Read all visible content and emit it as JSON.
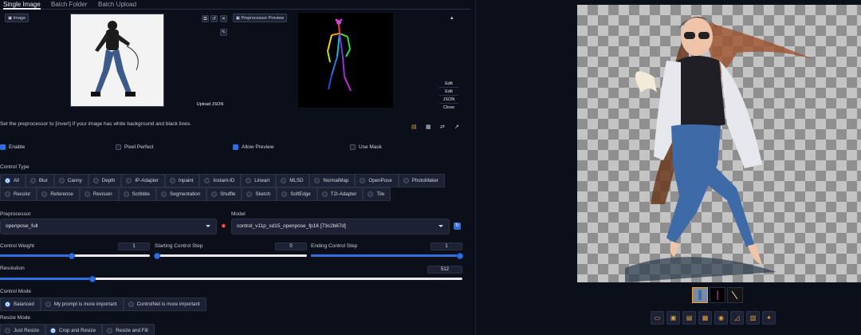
{
  "tabs": [
    {
      "label": "Single Image"
    },
    {
      "label": "Batch Folder"
    },
    {
      "label": "Batch Upload"
    }
  ],
  "image_panel": {
    "chip_label": "Image",
    "upload_json": "Upload JSON",
    "small_btns": [
      "⧉",
      "↺",
      "✕",
      "✎"
    ]
  },
  "preview_panel": {
    "chip_label": "Preprocessor Preview",
    "collapse": "▴"
  },
  "side_buttons": [
    "Edit",
    "Edit",
    "JSON",
    "Close"
  ],
  "hint": "Set the preprocessor to [invert] If your image has white background and black lines.",
  "checkboxes": [
    {
      "label": "Enable",
      "checked": true
    },
    {
      "label": "Pixel Perfect",
      "checked": false
    },
    {
      "label": "Allow Preview",
      "checked": true
    },
    {
      "label": "Use Mask",
      "checked": false
    }
  ],
  "control_type": {
    "label": "Control Type",
    "options": [
      "All",
      "Blur",
      "Canny",
      "Depth",
      "IP-Adapter",
      "Inpaint",
      "Instant-ID",
      "Lineart",
      "MLSD",
      "NormalMap",
      "OpenPose",
      "PhotoMaker",
      "Recolor",
      "Reference",
      "Revision",
      "Scribble",
      "Segmentation",
      "Shuffle",
      "Sketch",
      "SoftEdge",
      "T2I-Adapter",
      "Tile"
    ],
    "selected": "All"
  },
  "preprocessor": {
    "label": "Preprocessor",
    "value": "openpose_full"
  },
  "model": {
    "label": "Model",
    "value": "control_v11p_sd15_openpose_fp16 [73c2b67d]"
  },
  "sliders": {
    "control_weight": {
      "label": "Control Weight",
      "value": "1",
      "fraction": 0.48
    },
    "starting_step": {
      "label": "Starting Control Step",
      "value": "0",
      "fraction": 0.0
    },
    "ending_step": {
      "label": "Ending Control Step",
      "value": "1",
      "fraction": 1.0
    },
    "resolution": {
      "label": "Resolution",
      "value": "512",
      "fraction": 0.2
    }
  },
  "control_mode": {
    "label": "Control Mode",
    "options": [
      "Balanced",
      "My prompt is more important",
      "ControlNet is more important"
    ],
    "selected": "Balanced"
  },
  "resize_mode": {
    "label": "Resize Mode",
    "options": [
      "Just Resize",
      "Crop and Resize",
      "Resize and Fill"
    ],
    "selected": "Crop and Resize"
  },
  "toolbar_icons": [
    "folder-icon",
    "save-icon",
    "zip-icon",
    "image-icon",
    "palette-icon",
    "ruler-icon",
    "grid-icon",
    "sparkle-icon"
  ],
  "colors": {
    "accent": "#2f6fe0",
    "background": "#0b0f19",
    "surface": "#1c2233"
  }
}
